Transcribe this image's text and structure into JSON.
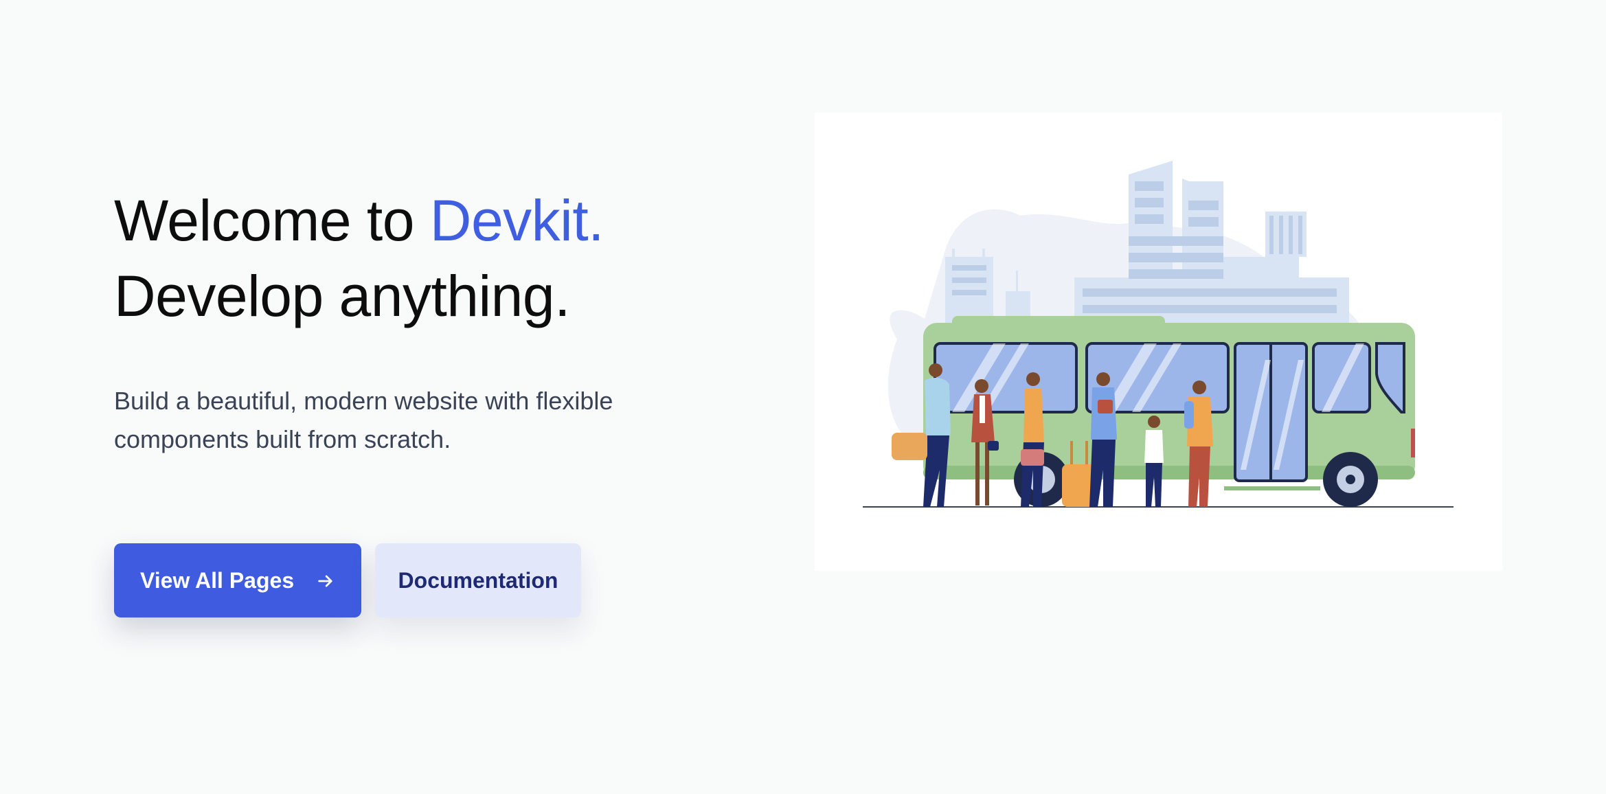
{
  "hero": {
    "headline_prefix": "Welcome to ",
    "headline_brand": "Devkit.",
    "headline_line2": "Develop anything.",
    "subtext": "Build a beautiful, modern website with flexible components built from scratch."
  },
  "actions": {
    "primary_label": "View All Pages",
    "primary_icon": "arrow-right-icon",
    "secondary_label": "Documentation"
  },
  "illustration": {
    "subject": "people-boarding-bus-illustration"
  },
  "colors": {
    "background": "#f9fafa",
    "accent": "#3f5fe0",
    "primary_button": "#3f5be0",
    "secondary_button": "#e3e7fa",
    "secondary_button_text": "#1e2a74",
    "bus_green": "#a9cf9a"
  }
}
